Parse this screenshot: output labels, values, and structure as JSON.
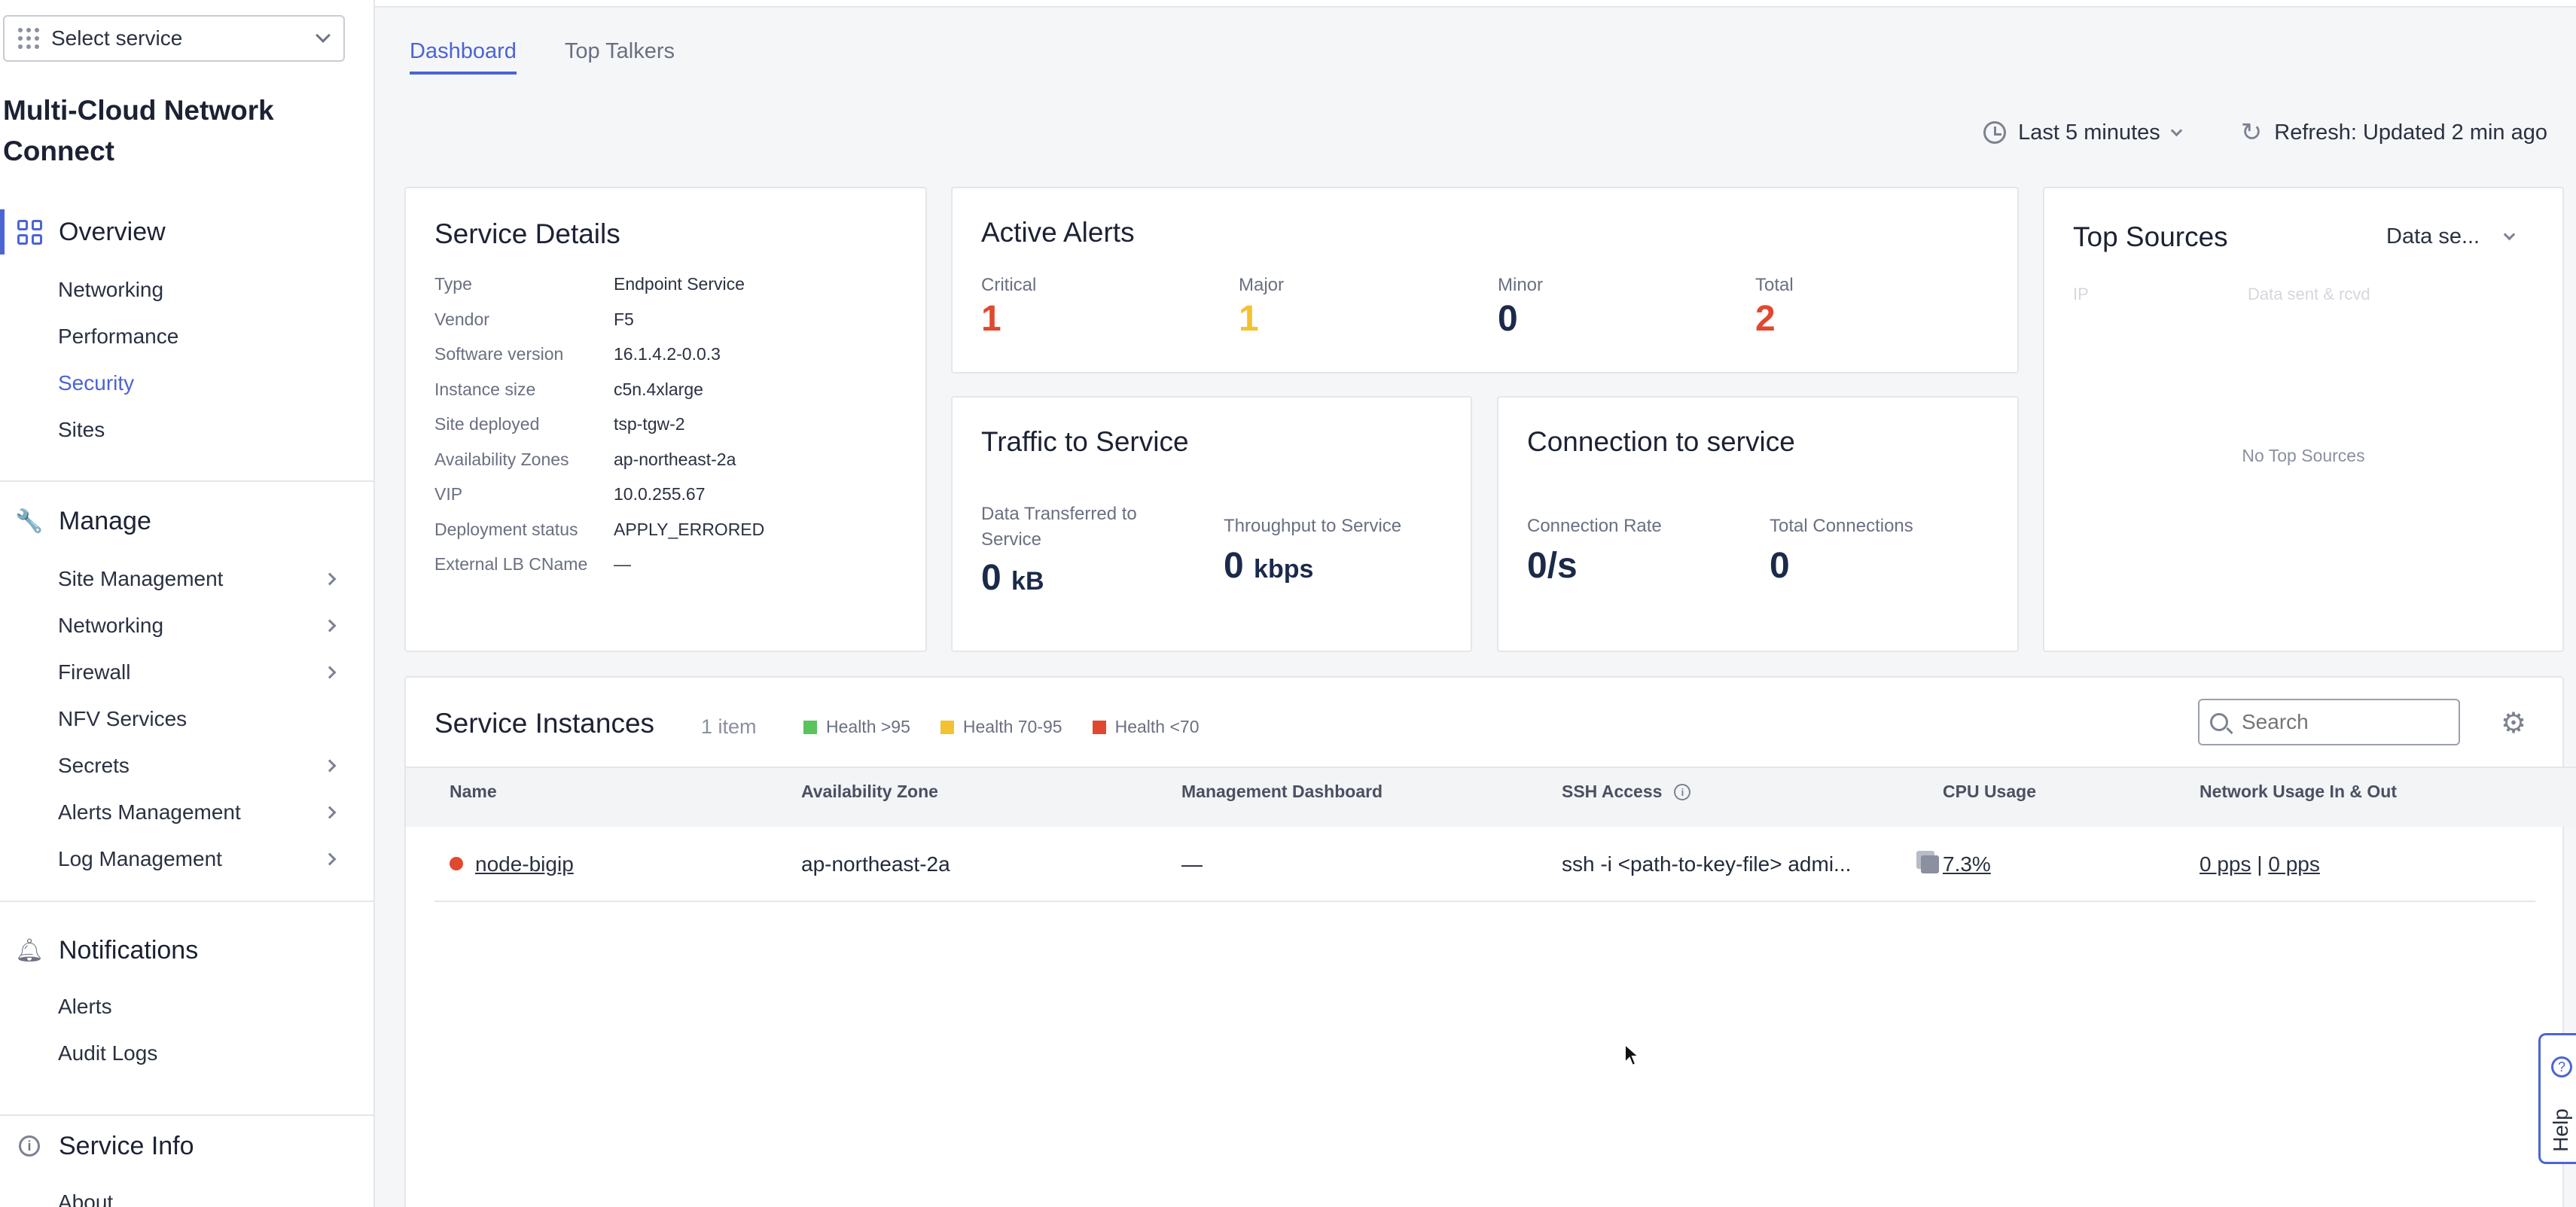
{
  "sidebar": {
    "service_select": "Select service",
    "app_title": "Multi-Cloud Network Connect",
    "overview": "Overview",
    "overview_items": [
      "Networking",
      "Performance",
      "Security",
      "Sites"
    ],
    "manage": "Manage",
    "manage_items": [
      "Site Management",
      "Networking",
      "Firewall",
      "NFV Services",
      "Secrets",
      "Alerts Management",
      "Log Management"
    ],
    "notifications": "Notifications",
    "notification_items": [
      "Alerts",
      "Audit Logs"
    ],
    "service_info": "Service Info",
    "service_info_items": [
      "About"
    ]
  },
  "tabs": [
    "Dashboard",
    "Top Talkers"
  ],
  "toolbar": {
    "time_range": "Last 5 minutes",
    "refresh": "Refresh: Updated 2 min ago"
  },
  "service_details": {
    "title": "Service Details",
    "rows": [
      {
        "k": "Type",
        "v": "Endpoint Service"
      },
      {
        "k": "Vendor",
        "v": "F5"
      },
      {
        "k": "Software version",
        "v": "16.1.4.2-0.0.3"
      },
      {
        "k": "Instance size",
        "v": "c5n.4xlarge"
      },
      {
        "k": "Site deployed",
        "v": "tsp-tgw-2"
      },
      {
        "k": "Availability Zones",
        "v": "ap-northeast-2a"
      },
      {
        "k": "VIP",
        "v": "10.0.255.67"
      },
      {
        "k": "Deployment status",
        "v": "APPLY_ERRORED"
      },
      {
        "k": "External LB CName",
        "v": "—"
      }
    ]
  },
  "active_alerts": {
    "title": "Active Alerts",
    "critical_label": "Critical",
    "critical": "1",
    "major_label": "Major",
    "major": "1",
    "minor_label": "Minor",
    "minor": "0",
    "total_label": "Total",
    "total": "2"
  },
  "traffic": {
    "title": "Traffic to Service",
    "transferred_label": "Data Transferred to Service",
    "transferred_value": "0",
    "transferred_unit": "kB",
    "throughput_label": "Throughput to Service",
    "throughput_value": "0",
    "throughput_unit": "kbps"
  },
  "connection": {
    "title": "Connection to service",
    "rate_label": "Connection Rate",
    "rate_value": "0/s",
    "total_label": "Total Connections",
    "total_value": "0"
  },
  "top_sources": {
    "title": "Top Sources",
    "dropdown": "Data se...",
    "col_ip": "IP",
    "col_data": "Data sent & rcvd",
    "empty": "No Top Sources"
  },
  "instances": {
    "title": "Service Instances",
    "count": "1 item",
    "legend": [
      {
        "label": "Health >95",
        "color": "#5cc25c"
      },
      {
        "label": "Health 70-95",
        "color": "#f2c230"
      },
      {
        "label": "Health <70",
        "color": "#e0492f"
      }
    ],
    "search_placeholder": "Search",
    "columns": [
      "Name",
      "Availability Zone",
      "Management Dashboard",
      "SSH Access",
      "CPU Usage",
      "Network Usage In & Out"
    ],
    "row": {
      "name": "node-bigip",
      "zone": "ap-northeast-2a",
      "dashboard": "—",
      "ssh": "ssh -i <path-to-key-file> admi...",
      "cpu": "7.3%",
      "net_in": "0 pps",
      "sep": "|",
      "net_out": "0 pps"
    }
  },
  "help": "Help",
  "colors": {
    "accent": "#4b64d6",
    "critical": "#e0492f",
    "major": "#f2c230",
    "value": "#1c2a4a"
  }
}
